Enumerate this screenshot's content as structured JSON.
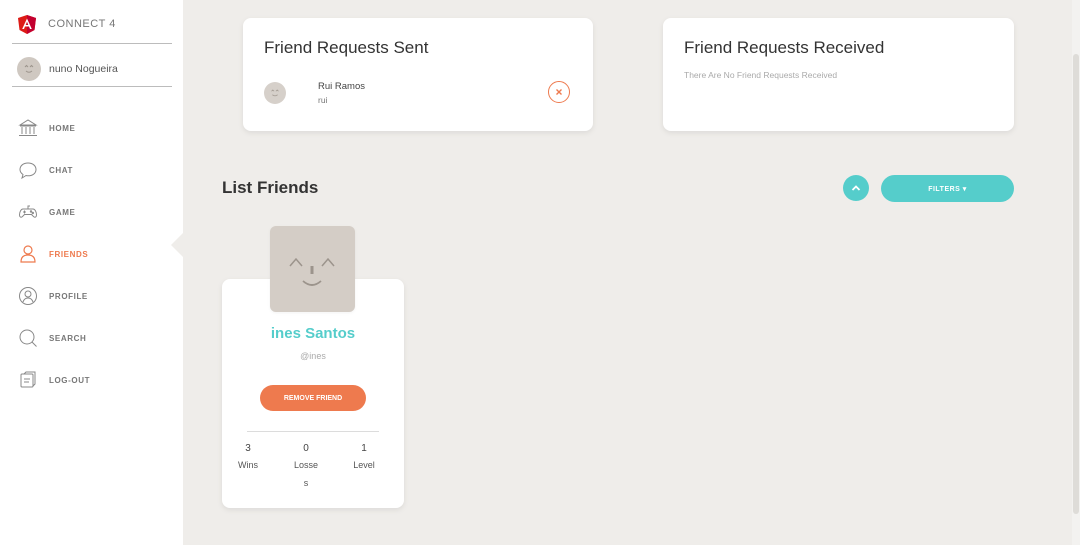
{
  "app": {
    "name": "CONNECT 4",
    "logo_icon": "angular-logo-icon",
    "accent": "#55cdcb",
    "danger": "#ee7a4e"
  },
  "user": {
    "name": "nuno Nogueira",
    "avatar_icon": "face-icon"
  },
  "nav": {
    "items": [
      {
        "label": "HOME",
        "icon": "bank-icon"
      },
      {
        "label": "CHAT",
        "icon": "chat-icon"
      },
      {
        "label": "GAME",
        "icon": "gamepad-icon"
      },
      {
        "label": "FRIENDS",
        "icon": "person-icon"
      },
      {
        "label": "PROFILE",
        "icon": "profile-icon"
      },
      {
        "label": "SEARCH",
        "icon": "search-icon"
      },
      {
        "label": "LOG-OUT",
        "icon": "logout-icon"
      }
    ]
  },
  "requests_sent": {
    "title": "Friend Requests Sent",
    "items": [
      {
        "name": "Rui Ramos",
        "username": "rui",
        "action_icon": "close-icon"
      }
    ]
  },
  "requests_received": {
    "title": "Friend Requests Received",
    "empty_message": "There Are No Friend Requests Received"
  },
  "friends": {
    "title": "List Friends",
    "up_icon": "chevron-up-icon",
    "filters_label": "FILTERS ▾",
    "items": [
      {
        "name": "ines Santos",
        "handle": "@ines",
        "remove_label": "REMOVE FRIEND",
        "stats": [
          {
            "value": "3",
            "label": "Wins"
          },
          {
            "value": "0",
            "label": "Losses"
          },
          {
            "value": "1",
            "label": "Level"
          }
        ]
      }
    ]
  }
}
